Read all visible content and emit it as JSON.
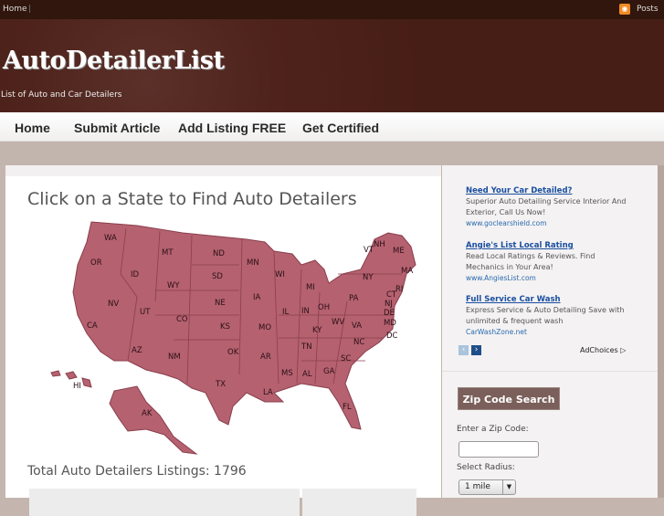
{
  "topbar": {
    "home": "Home",
    "posts": "Posts",
    "rss_icon": "rss-icon"
  },
  "header": {
    "title": "AutoDetailerList",
    "tagline": "List of Auto and Car Detailers"
  },
  "nav": [
    {
      "label": "Home"
    },
    {
      "label": "Submit Article"
    },
    {
      "label": "Add Listing FREE"
    },
    {
      "label": "Get Certified"
    }
  ],
  "main": {
    "title": "Click on a State to Find Auto Detailers",
    "total": "Total Auto Detailers Listings: 1796",
    "map_color": "#b5616f",
    "states": [
      "WA",
      "OR",
      "ID",
      "MT",
      "WY",
      "NV",
      "UT",
      "CA",
      "AZ",
      "CO",
      "NM",
      "ND",
      "SD",
      "NE",
      "KS",
      "OK",
      "TX",
      "MN",
      "IA",
      "MO",
      "AR",
      "LA",
      "WI",
      "IL",
      "MS",
      "MI",
      "IN",
      "KY",
      "TN",
      "AL",
      "OH",
      "WV",
      "GA",
      "FL",
      "SC",
      "NC",
      "VA",
      "PA",
      "NY",
      "VT",
      "NH",
      "ME",
      "MA",
      "CT",
      "RI",
      "NJ",
      "DE",
      "MD",
      "DC",
      "HI",
      "AK"
    ]
  },
  "ads": [
    {
      "title": "Need Your Car Detailed?",
      "text": "Superior Auto Detailing Service Interior And Exterior, Call Us Now!",
      "url": "www.goclearshield.com"
    },
    {
      "title": "Angie's List Local Rating",
      "text": "Read Local Ratings & Reviews. Find Mechanics in Your Area!",
      "url": "www.AngiesList.com"
    },
    {
      "title": "Full Service Car Wash",
      "text": "Express Service & Auto Detailing Save with unlimited & frequent wash",
      "url": "CarWashZone.net"
    }
  ],
  "adchoices": "AdChoices ▷",
  "zip": {
    "button": "Zip Code Search",
    "zip_label": "Enter a Zip Code:",
    "zip_value": "",
    "radius_label": "Select Radius:",
    "radius_value": "1 mile"
  }
}
